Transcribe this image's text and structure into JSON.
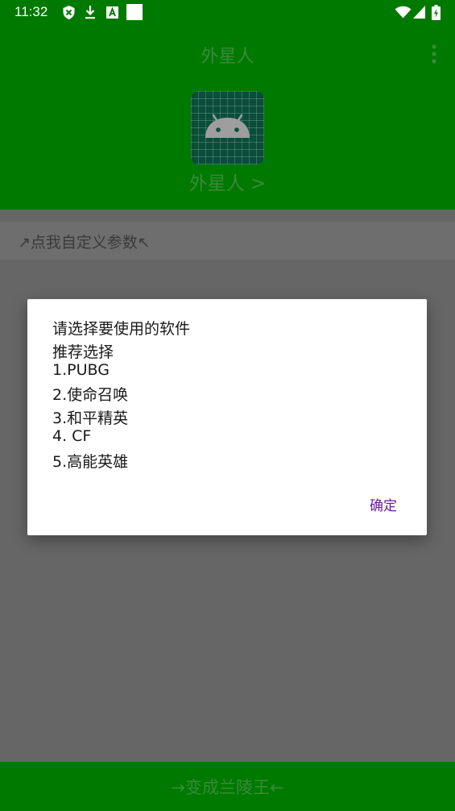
{
  "status_bar": {
    "time": "11:32",
    "icons": [
      "shield-icon",
      "download-icon",
      "a-box-icon",
      "white-square-icon",
      "wifi-icon",
      "cell-signal-icon",
      "battery-charging-icon"
    ]
  },
  "header": {
    "title": "外星人",
    "app_icon": "android-robot-icon",
    "app_name_link": "外星人 >",
    "more_icon": "more-vert-icon"
  },
  "param_row": {
    "label": "↗点我自定义参数↖"
  },
  "dialog": {
    "lines": [
      "请选择要使用的软件",
      "推荐选择",
      "1.PUBG",
      "2.使命召唤",
      "3.和平精英",
      "4. CF",
      "5.高能英雄"
    ],
    "ok_label": "确定"
  },
  "bottom_bar": {
    "label": "→变成兰陵王←"
  },
  "colors": {
    "primary_green": "#007900",
    "scrim_gray": "#666666",
    "dialog_button": "#6a1b9a"
  }
}
